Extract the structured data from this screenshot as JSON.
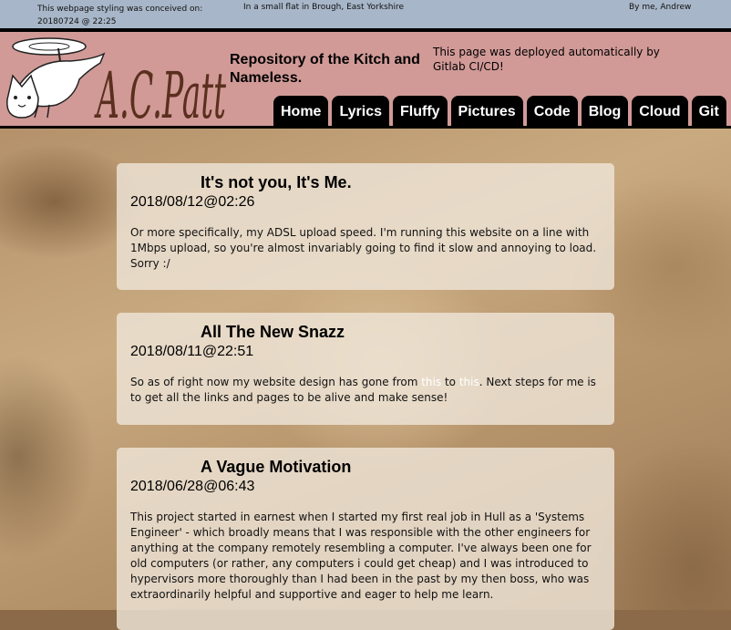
{
  "topbar": {
    "conceived": "This webpage styling was conceived on: 20180724 @ 22:25",
    "location": "In a small flat in Brough, East Yorkshire",
    "byline": "By me, Andrew"
  },
  "header": {
    "logo_text": "A.C.Patt",
    "title": "Repository of the Kitch and Nameless.",
    "deploy_note": "This page was deployed automatically by Gitlab CI/CD!"
  },
  "nav": [
    "Home",
    "Lyrics",
    "Fluffy",
    "Pictures",
    "Code",
    "Blog",
    "Cloud",
    "Git"
  ],
  "posts": [
    {
      "title": "It's not you, It's Me.",
      "date": "2018/08/12@02:26",
      "body": "Or more specifically, my ADSL upload speed. I'm running this website on a line with 1Mbps upload, so you're almost invariably going to find it slow and annoying to load. Sorry :/"
    },
    {
      "title": "All The New Snazz",
      "date": "2018/08/11@22:51",
      "body_before": "So as of right now my website design has gone from ",
      "link1": "this",
      "body_mid": " to ",
      "link2": "this",
      "body_after": ". Next steps for me is to get all the links and pages to be alive and make sense!"
    },
    {
      "title": "A Vague Motivation",
      "date": "2018/06/28@06:43",
      "body": "This project started in earnest when I started my first real job in Hull as a 'Systems Engineer' - which broadly means that I was responsible with the other engineers for anything at the company remotely resembling a computer. I've always been one for old computers (or rather, any computers i could get cheap) and I was introduced to hypervisors more thoroughly than I had been in the past by my then boss, who was extraordinarily helpful and supportive and eager to help me learn."
    }
  ]
}
